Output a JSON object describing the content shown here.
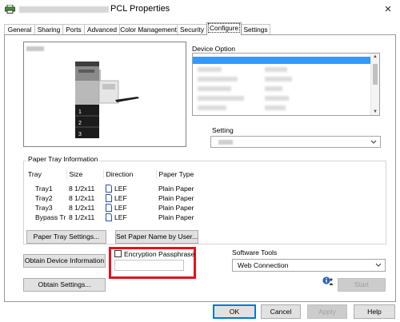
{
  "window": {
    "title": "PCL Properties",
    "close_glyph": "×"
  },
  "tabs": [
    "General",
    "Sharing",
    "Ports",
    "Advanced",
    "Color Management",
    "Security",
    "Configure",
    "Settings"
  ],
  "active_tab": "Configure",
  "device_option": {
    "label": "Device Option",
    "setting_label": "Setting"
  },
  "printer_preview": {
    "tray_labels": [
      "1",
      "2",
      "3"
    ]
  },
  "paper_tray": {
    "title": "Paper Tray Information",
    "columns": [
      "Tray",
      "Size",
      "Direction",
      "Paper Type"
    ],
    "rows": [
      {
        "tray": "Tray1",
        "size": "8 1/2x11",
        "direction": "LEF",
        "type": "Plain Paper"
      },
      {
        "tray": "Tray2",
        "size": "8 1/2x11",
        "direction": "LEF",
        "type": "Plain Paper"
      },
      {
        "tray": "Tray3",
        "size": "8 1/2x11",
        "direction": "LEF",
        "type": "Plain Paper"
      },
      {
        "tray": "Bypass Tr",
        "size": "8 1/2x11",
        "direction": "LEF",
        "type": "Plain Paper"
      }
    ]
  },
  "buttons": {
    "paper_tray_settings": "Paper Tray Settings...",
    "set_paper_name": "Set Paper Name by User...",
    "obtain_device_info": "Obtain Device Information",
    "obtain_settings": "Obtain Settings...",
    "start": "Start",
    "ok": "OK",
    "cancel": "Cancel",
    "apply": "Apply",
    "help": "Help"
  },
  "encryption": {
    "label": "Encryption Passphrase",
    "checked": false,
    "value": ""
  },
  "software_tools": {
    "label": "Software Tools",
    "selected": "Web Connection"
  },
  "icons": {
    "app": "printer-icon",
    "info": "info-person-icon",
    "direction": "document-lef-icon",
    "dropdown": "chevron-down-icon"
  },
  "colors": {
    "selection": "#3399ff",
    "highlight_box": "#e8101a",
    "default_button_border": "#0078d7"
  }
}
